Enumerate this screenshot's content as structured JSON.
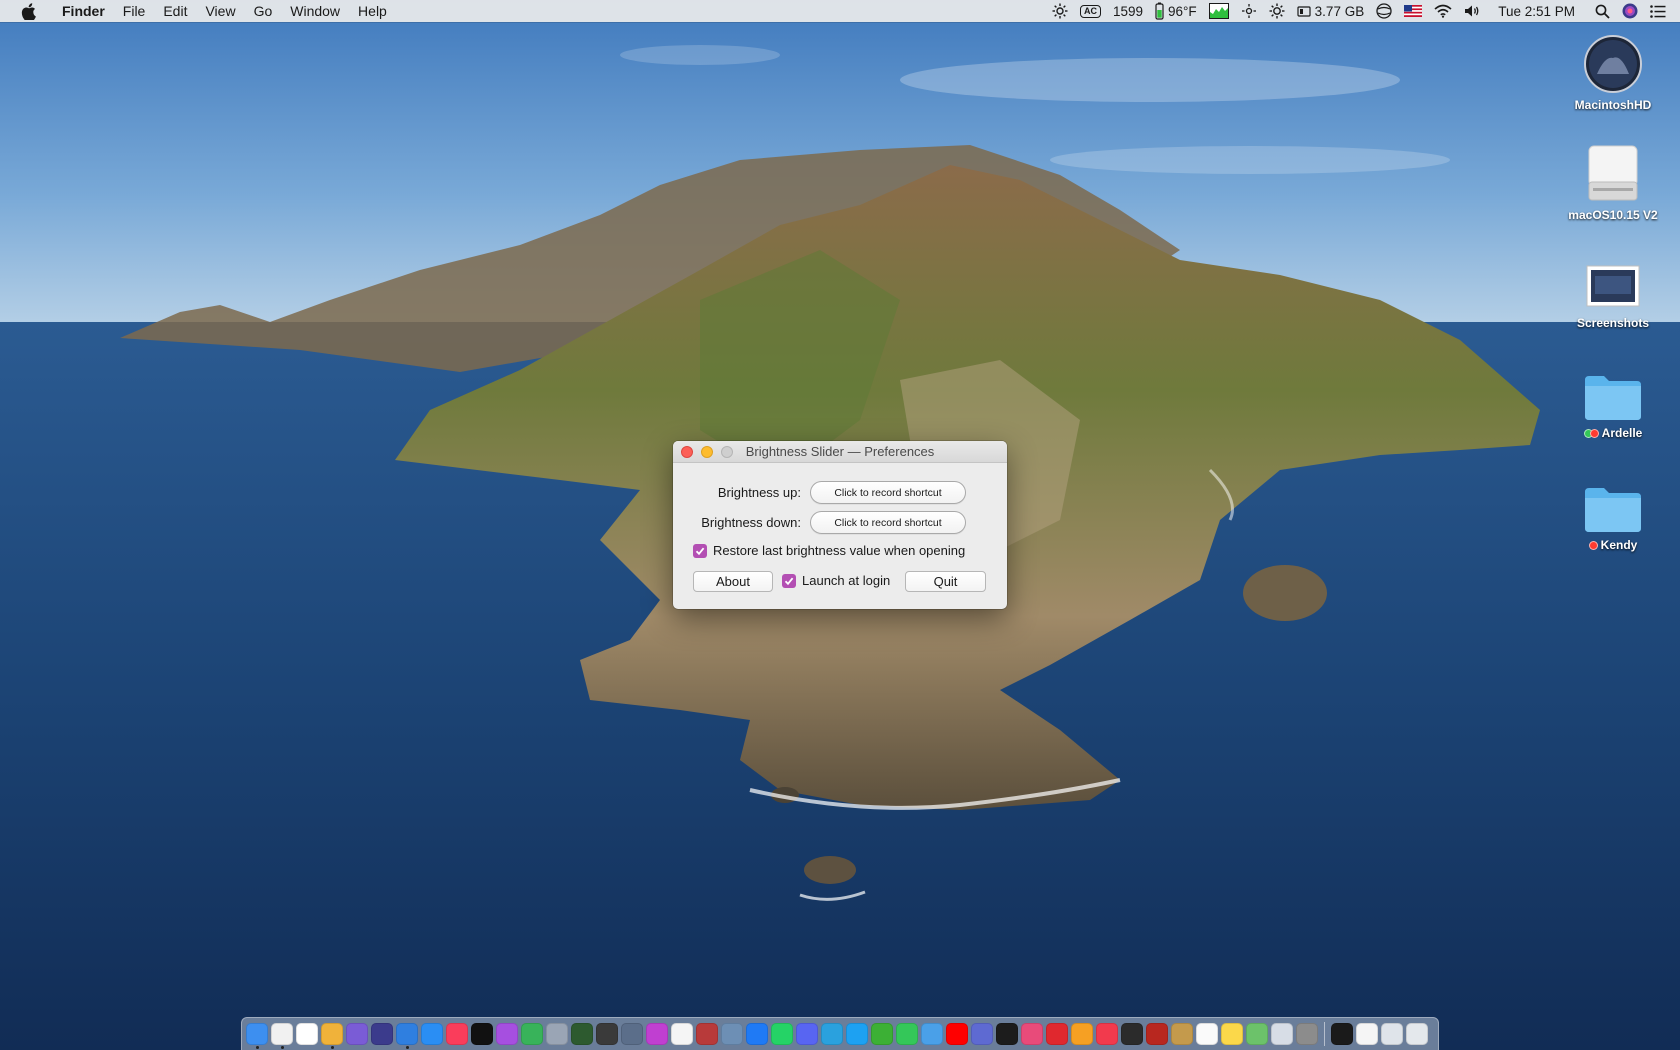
{
  "menubar": {
    "apple_icon": "apple-logo-icon",
    "app_name": "Finder",
    "menus": [
      "File",
      "Edit",
      "View",
      "Go",
      "Window",
      "Help"
    ],
    "status": {
      "power_source": "AC",
      "cpu_value": "1599",
      "temperature": "96°F",
      "memory": "3.77 GB",
      "clock": "Tue 2:51 PM"
    }
  },
  "desktop": {
    "icons": [
      {
        "label": "MacintoshHD",
        "icon": "hard-drive-icon"
      },
      {
        "label": "macOS10.15 V2",
        "icon": "external-drive-icon"
      },
      {
        "label": "Screenshots",
        "icon": "screenshot-icon"
      },
      {
        "label": "Ardelle",
        "icon": "folder-icon",
        "tags": [
          "#34c759",
          "#ff3b30"
        ]
      },
      {
        "label": "Kendy",
        "icon": "folder-icon",
        "tags": [
          "#ff3b30"
        ]
      }
    ]
  },
  "window": {
    "title": "Brightness Slider — Preferences",
    "brightness_up_label": "Brightness up:",
    "brightness_up_button": "Click to record shortcut",
    "brightness_down_label": "Brightness down:",
    "brightness_down_button": "Click to record shortcut",
    "restore_checkbox_label": "Restore last brightness value when opening",
    "restore_checked": true,
    "about_button": "About",
    "launch_checkbox_label": "Launch at login",
    "launch_checked": true,
    "quit_button": "Quit",
    "accent_color": "#b34fb3"
  },
  "dock": {
    "apps": [
      {
        "name": "Finder",
        "color": "#3d8ff0",
        "running": true
      },
      {
        "name": "Clock",
        "color": "#f1f1f1",
        "running": true
      },
      {
        "name": "Calendar",
        "color": "#ffffff"
      },
      {
        "name": "Weather",
        "color": "#f0b23a",
        "running": true
      },
      {
        "name": "Launchpad",
        "color": "#7a5cd6"
      },
      {
        "name": "Siri",
        "color": "#3b3b8c"
      },
      {
        "name": "Safari",
        "color": "#2f7fe0",
        "running": true
      },
      {
        "name": "App Store",
        "color": "#2a8ef4"
      },
      {
        "name": "Music",
        "color": "#fa3d5b"
      },
      {
        "name": "Apple TV",
        "color": "#111111"
      },
      {
        "name": "Podcasts",
        "color": "#a64fe0"
      },
      {
        "name": "Find My",
        "color": "#38b35a"
      },
      {
        "name": "Rocket",
        "color": "#9aa5b5"
      },
      {
        "name": "Mosaic",
        "color": "#2d5a2f"
      },
      {
        "name": "Camera",
        "color": "#3a3a3a"
      },
      {
        "name": "Backdrop",
        "color": "#5b6e8a"
      },
      {
        "name": "Flower",
        "color": "#c03fd1"
      },
      {
        "name": "Photos",
        "color": "#f5f5f5"
      },
      {
        "name": "Grid",
        "color": "#b83a3a"
      },
      {
        "name": "Preview",
        "color": "#6d8fb5"
      },
      {
        "name": "Messenger",
        "color": "#1f7af5"
      },
      {
        "name": "WhatsApp",
        "color": "#25d366"
      },
      {
        "name": "Discord",
        "color": "#5865f2"
      },
      {
        "name": "Telegram",
        "color": "#2aa1de"
      },
      {
        "name": "Twitter",
        "color": "#1da1f2"
      },
      {
        "name": "WeChat",
        "color": "#3cb035"
      },
      {
        "name": "Messages",
        "color": "#34c759"
      },
      {
        "name": "Finder Mini",
        "color": "#4aa0e8"
      },
      {
        "name": "YouTube",
        "color": "#ff0000"
      },
      {
        "name": "Linear",
        "color": "#5e6ad2"
      },
      {
        "name": "QuickTime",
        "color": "#1c1c1c"
      },
      {
        "name": "Notion",
        "color": "#e84b7a"
      },
      {
        "name": "Cast",
        "color": "#e0282e"
      },
      {
        "name": "Home",
        "color": "#f6a023"
      },
      {
        "name": "News",
        "color": "#f23a4d"
      },
      {
        "name": "Activity",
        "color": "#2b2b2b"
      },
      {
        "name": "Pages",
        "color": "#b8271f"
      },
      {
        "name": "Notebook",
        "color": "#c49a4c"
      },
      {
        "name": "TextEdit",
        "color": "#fafafa"
      },
      {
        "name": "Notes",
        "color": "#fbd84a"
      },
      {
        "name": "Maps",
        "color": "#6cc26a"
      },
      {
        "name": "Editor",
        "color": "#d7dde6"
      },
      {
        "name": "System Preferences",
        "color": "#8c8c8c"
      }
    ],
    "utilities": [
      {
        "name": "Terminal",
        "color": "#1a1a1a"
      },
      {
        "name": "Document",
        "color": "#f5f5f5"
      },
      {
        "name": "Mail Folder",
        "color": "#dfe4ea"
      },
      {
        "name": "Trash",
        "color": "#e4e8ec"
      }
    ]
  }
}
